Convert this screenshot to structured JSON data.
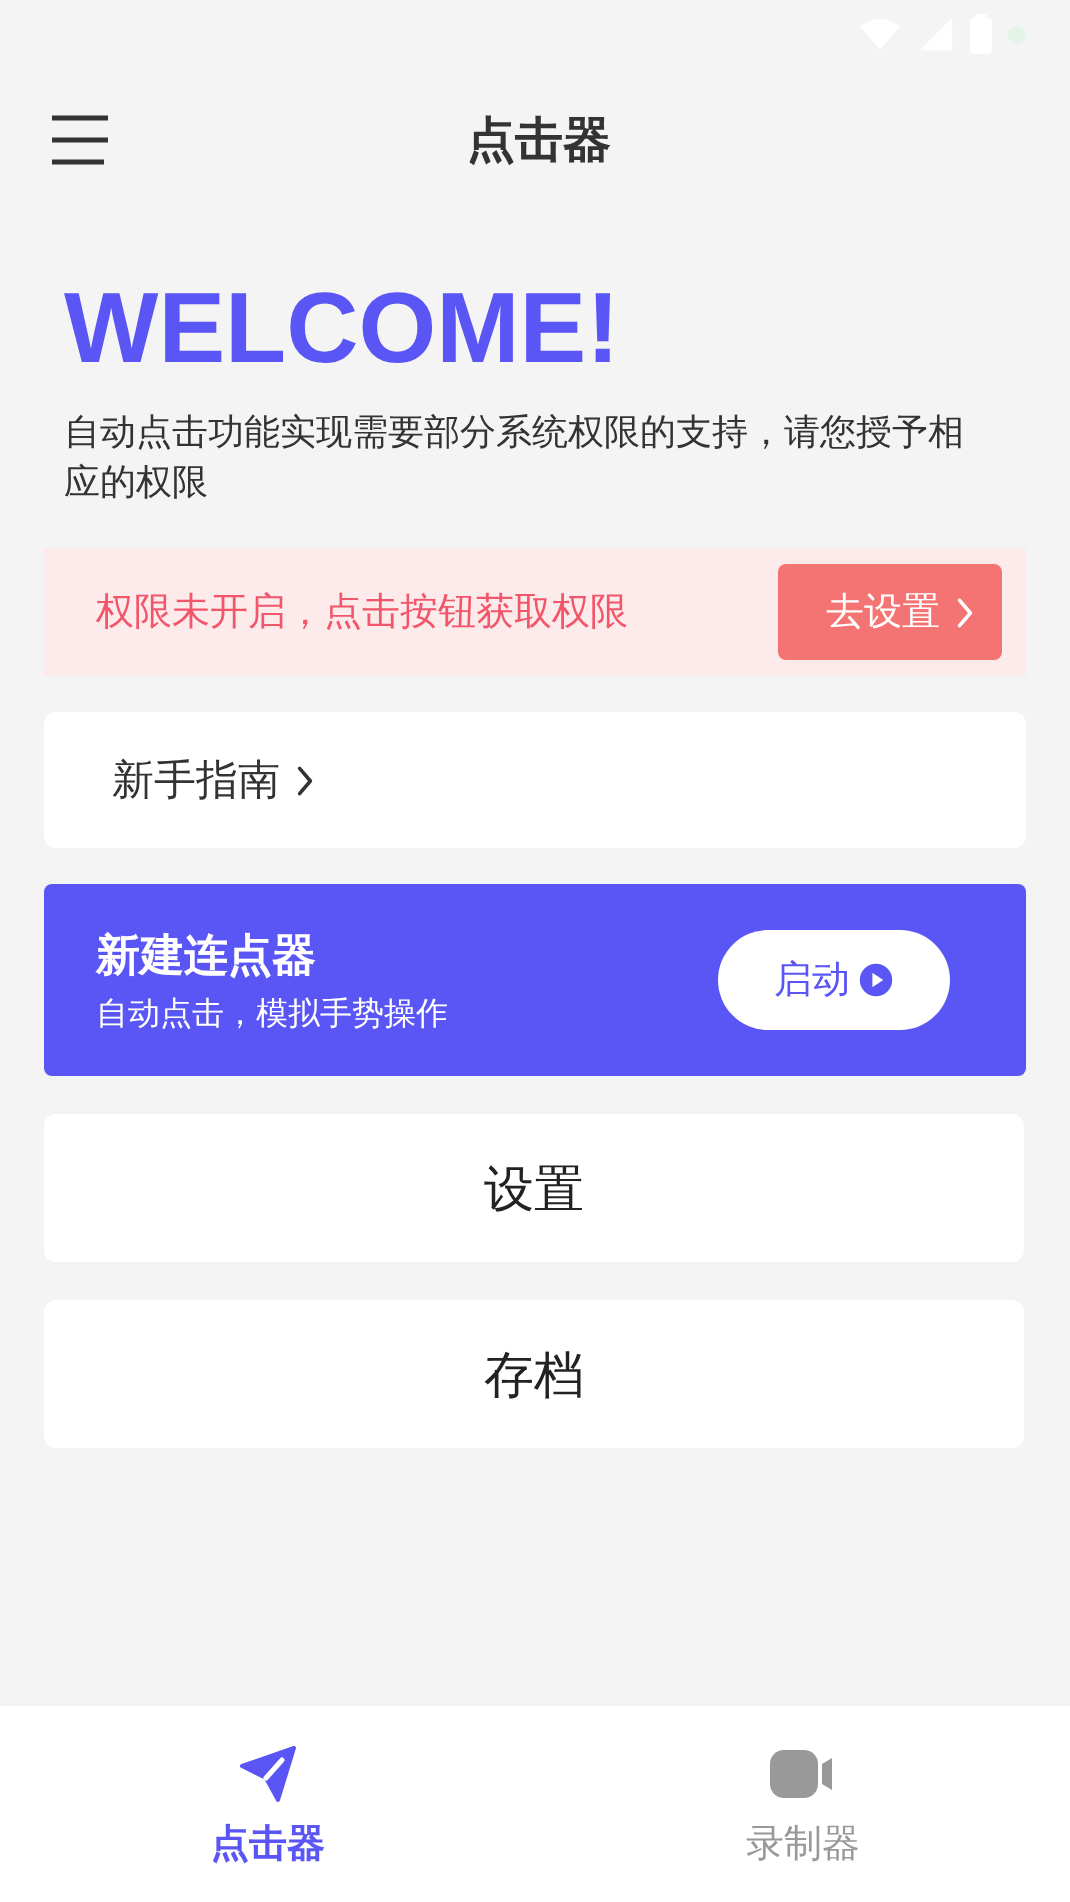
{
  "header": {
    "title": "点击器"
  },
  "welcome": {
    "heading": "WELCOME!",
    "description": "自动点击功能实现需要部分系统权限的支持，请您授予相应的权限"
  },
  "permission_banner": {
    "message": "权限未开启，点击按钮获取权限",
    "button": "去设置"
  },
  "guide": {
    "label": "新手指南"
  },
  "new_clicker": {
    "title": "新建连点器",
    "subtitle": "自动点击，模拟手势操作",
    "button": "启动"
  },
  "menu_buttons": [
    "设置",
    "存档"
  ],
  "bottom_nav": [
    {
      "label": "点击器",
      "selected": true
    },
    {
      "label": "录制器",
      "selected": false
    }
  ]
}
